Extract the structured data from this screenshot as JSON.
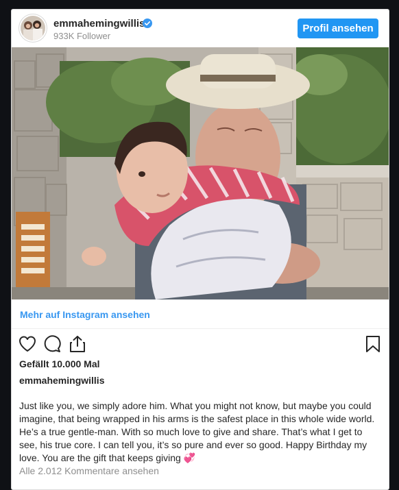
{
  "post": {
    "username": "emmahemingwillis",
    "followers": "933K Follower",
    "profile_button": "Profil ansehen",
    "view_more": "Mehr auf Instagram ansehen",
    "likes": "Gefällt 10.000 Mal",
    "caption_username": "emmahemingwillis",
    "caption": "Just like you, we simply adore him. What you might not know, but maybe you could imagine, that being wrapped in his arms is the safest place in this whole wide world. He’s a true gentle-man. With so much love to give and share. That’s what I get to see, his true core. I can tell you, it’s so pure and ever so good. Happy Birthday my love. You are the gift that keeps giving 💞",
    "comments_link": "Alle 2.012 Kommentare ansehen"
  },
  "icons": {
    "verified": "verified-badge-icon",
    "like": "heart-icon",
    "comment": "comment-bubble-icon",
    "share": "share-icon",
    "save": "bookmark-icon"
  },
  "colors": {
    "accent": "#3897f0",
    "button": "#2196f3",
    "text": "#262626",
    "muted": "#8e8e8e"
  }
}
